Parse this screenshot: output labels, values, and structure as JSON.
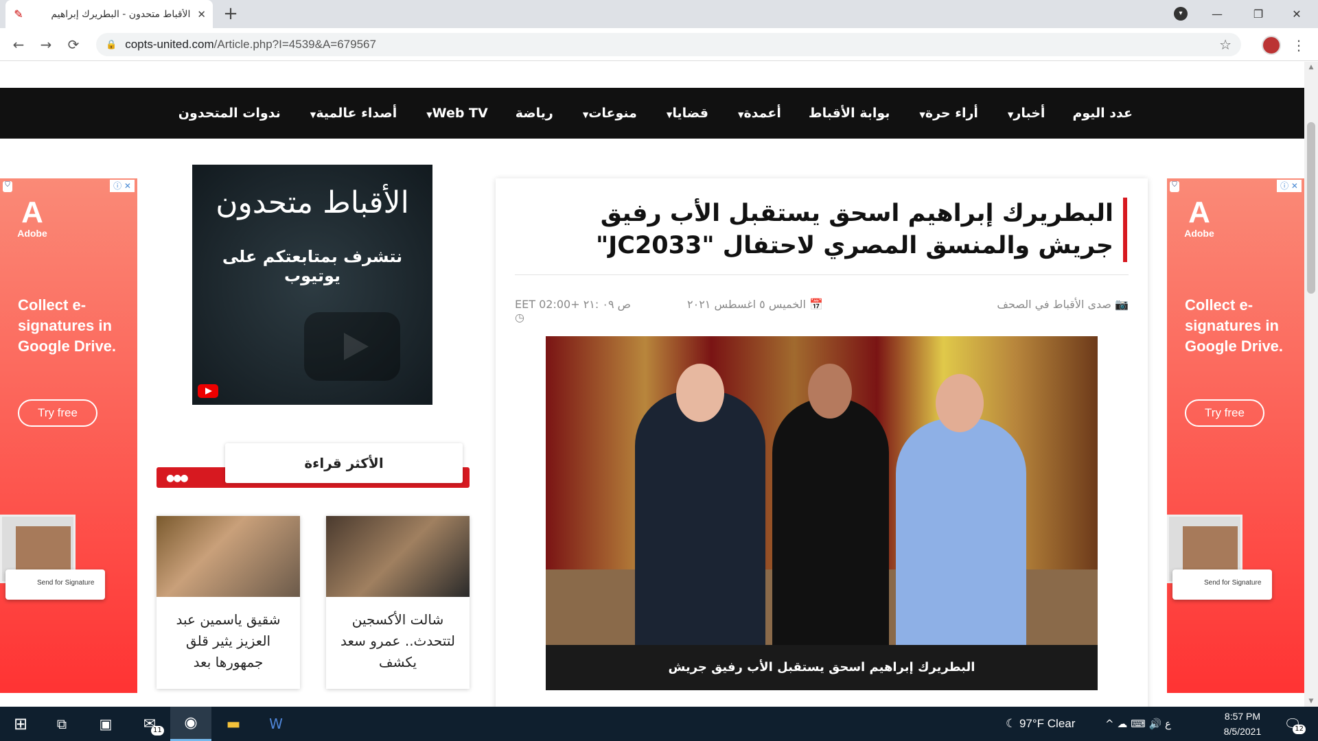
{
  "browser": {
    "tab_title": "الأقباط متحدون - البطريرك إبراهيم",
    "tab_close": "✕",
    "new_tab": "+",
    "url_domain": "copts-united.com",
    "url_path": "/Article.php?I=4539&A=679567",
    "back": "←",
    "forward": "→",
    "reload": "⟳",
    "star": "☆",
    "menu": "⋮",
    "minimize": "—",
    "maximize": "❐",
    "close": "✕"
  },
  "nav": {
    "items": [
      "عدد اليوم",
      "أخبار",
      "أراء حرة",
      "بوابة الأقباط",
      "أعمدة",
      "قضايا",
      "منوعات",
      "رياضة",
      "Web TV",
      "أصداء عالمية",
      "ندوات المتحدون"
    ],
    "dropdown": [
      false,
      true,
      true,
      false,
      true,
      true,
      true,
      false,
      true,
      true,
      false
    ]
  },
  "ad": {
    "brand": "Adobe",
    "headline": "Collect e-signatures in Google Drive.",
    "cta": "Try free",
    "card_text": "Send for Signature"
  },
  "youtube_box": {
    "title": "الأقباط متحدون",
    "subtitle": "نتشرف بمتابعتكم على يوتيوب"
  },
  "most_read": {
    "title": "الأكثر قراءة",
    "cards": [
      {
        "caption": "شالت الأكسجين لتتحدث.. عمرو سعد يكشف"
      },
      {
        "caption": "شقيق ياسمين عبد العزيز يثير قلق جمهورها بعد"
      }
    ]
  },
  "article": {
    "headline": "البطريرك إبراهيم اسحق يستقبل الأب رفيق جريش والمنسق المصري لاحتفال \"JC2033\"",
    "category": "صدى الأقباط في الصحف",
    "date": "الخميس ٥ اغسطس ٢٠٢١",
    "time": "EET 02:00+ ص ٠٩ :٢١",
    "image_caption": "البطريرك إبراهيم اسحق يستقبل الأب رفيق جريش"
  },
  "taskbar": {
    "mail_badge": "11",
    "weather": "97°F  Clear",
    "tray": "^  ☁  ⌨  🔊  ع",
    "time": "8:57 PM",
    "date": "8/5/2021",
    "notif_badge": "12"
  },
  "colors": {
    "accent_red": "#d71920",
    "nav_bg": "#111111"
  }
}
